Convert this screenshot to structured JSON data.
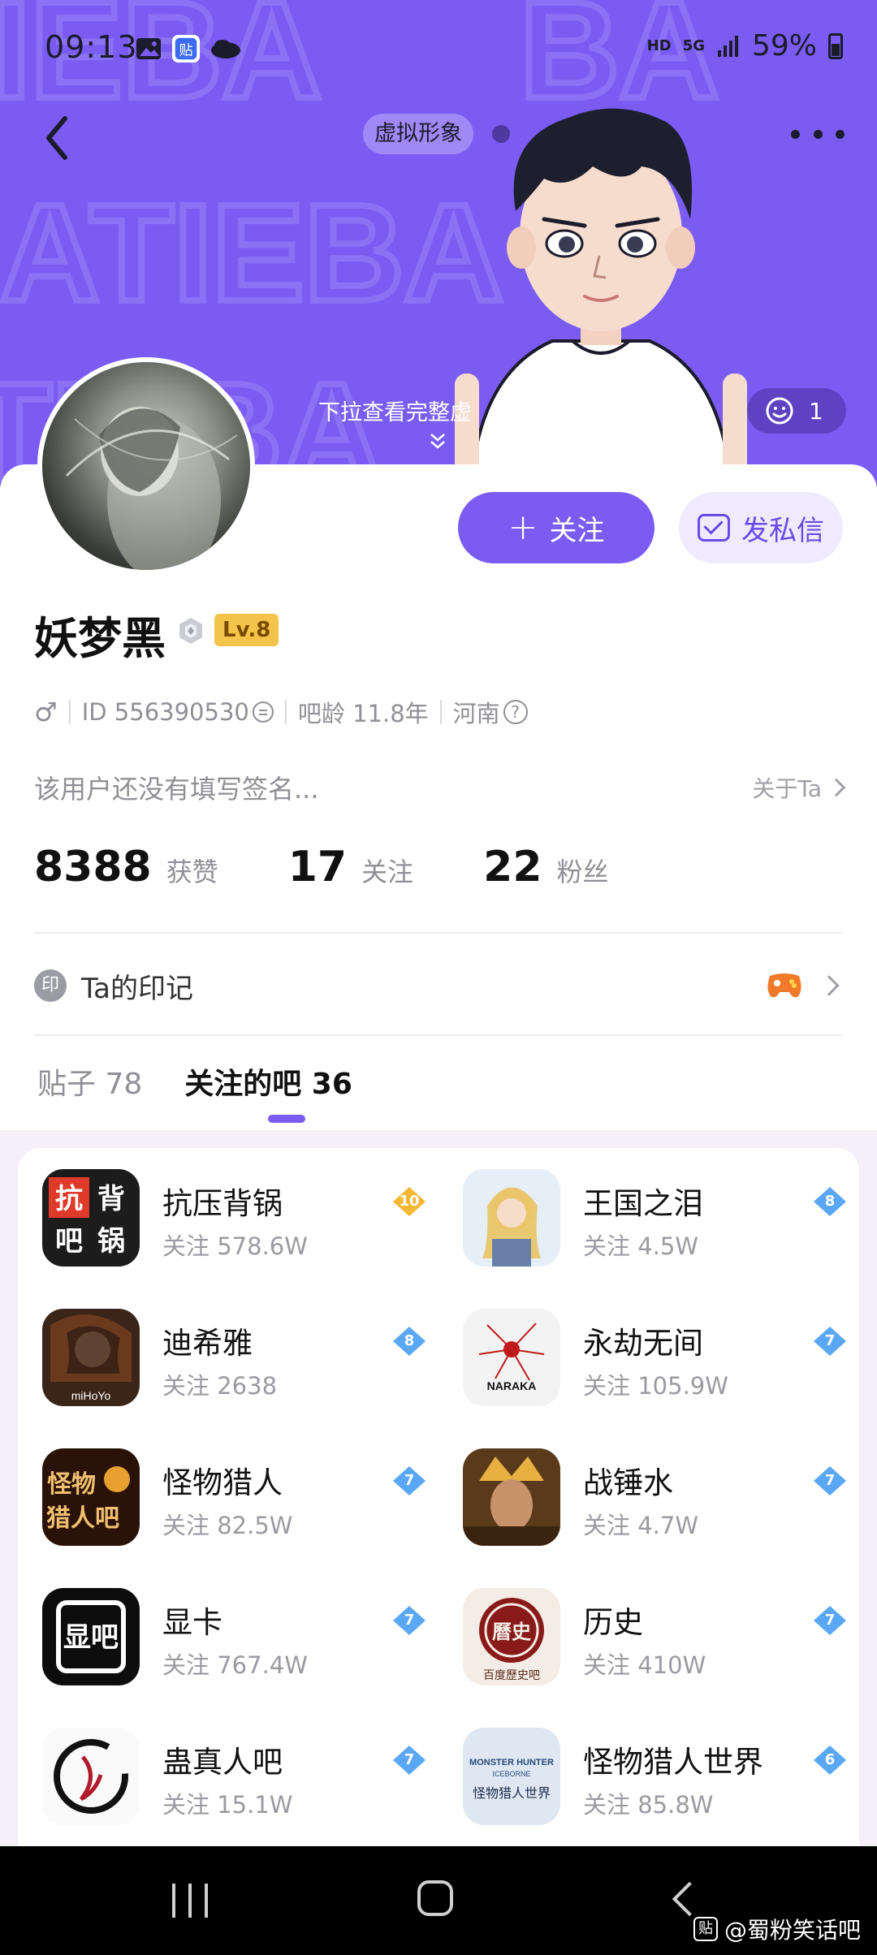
{
  "status_bar": {
    "time": "09:13",
    "net_hd": "HD",
    "net_5g": "5G",
    "battery": "59%"
  },
  "header": {
    "virtual_chip": "虚拟形象",
    "pull_hint": "下拉查看完整虚",
    "like_count": "1"
  },
  "profile": {
    "username": "妖梦黑",
    "level": "Lv.8",
    "gender_icon": "♂",
    "id_text": "ID 556390530",
    "forum_age": "吧龄 11.8年",
    "location": "河南",
    "signature": "该用户还没有填写签名...",
    "about_link": "关于Ta",
    "follow_label": "关注",
    "message_label": "发私信"
  },
  "stats": [
    {
      "num": "8388",
      "label": "获赞"
    },
    {
      "num": "17",
      "label": "关注"
    },
    {
      "num": "22",
      "label": "粉丝"
    }
  ],
  "marks": {
    "label": "Ta的印记",
    "icon_char": "印"
  },
  "tabs": [
    {
      "label": "贴子 78",
      "active": false
    },
    {
      "label": "关注的吧 36",
      "active": true
    }
  ],
  "forums": [
    {
      "name": "抗压背锅",
      "count": "关注 578.6W",
      "level": "10",
      "badge_color": "#f5b731"
    },
    {
      "name": "王国之泪",
      "count": "关注 4.5W",
      "level": "8",
      "badge_color": "#5aa8f5"
    },
    {
      "name": "迪希雅",
      "count": "关注 2638",
      "level": "8",
      "badge_color": "#5aa8f5"
    },
    {
      "name": "永劫无间",
      "count": "关注 105.9W",
      "level": "7",
      "badge_color": "#5aa8f5"
    },
    {
      "name": "怪物猎人",
      "count": "关注 82.5W",
      "level": "7",
      "badge_color": "#5aa8f5"
    },
    {
      "name": "战锤水",
      "count": "关注 4.7W",
      "level": "7",
      "badge_color": "#5aa8f5"
    },
    {
      "name": "显卡",
      "count": "关注 767.4W",
      "level": "7",
      "badge_color": "#5aa8f5"
    },
    {
      "name": "历史",
      "count": "关注 410W",
      "level": "7",
      "badge_color": "#5aa8f5"
    },
    {
      "name": "蛊真人吧",
      "count": "关注 15.1W",
      "level": "7",
      "badge_color": "#5aa8f5"
    },
    {
      "name": "怪物猎人世界",
      "count": "关注 85.8W",
      "level": "6",
      "badge_color": "#5aa8f5"
    }
  ],
  "forum_thumb_texts": {
    "kangya": "抗压背锅吧",
    "wangguo": "",
    "dixiya": "miHoYo",
    "yongjie": "NARAKA",
    "guaiwu": "怪物猎人吧",
    "zhanchui": "",
    "xianka": "显卡吧",
    "lishi": "百度歷史吧",
    "guzhenren": "",
    "mhw": "MONSTER HUNTER ICEBORNE"
  },
  "watermark": {
    "icon": "贴",
    "text": "@蜀粉笑话吧"
  },
  "colors": {
    "primary": "#7a5cf3",
    "banner": "#7a5cf3",
    "gold": "#f4c44a"
  }
}
